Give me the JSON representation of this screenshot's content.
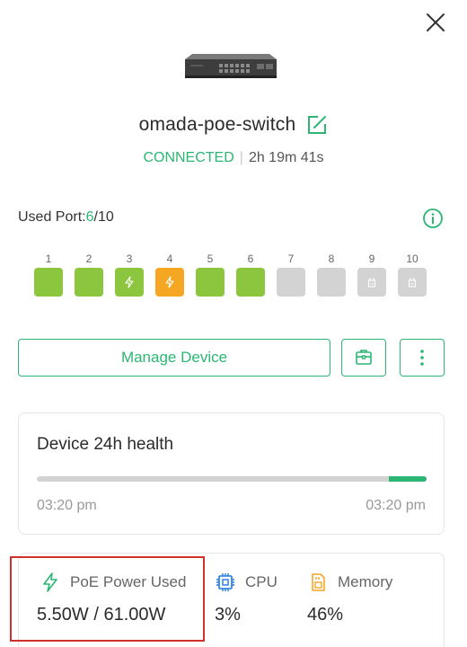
{
  "device": {
    "name": "omada-poe-switch",
    "status": "CONNECTED",
    "uptime": "2h 19m 41s"
  },
  "ports": {
    "label": "Used Port:",
    "used": "6",
    "total": "/10",
    "items": [
      {
        "num": "1",
        "state": "connected",
        "color": "#8cc63f"
      },
      {
        "num": "2",
        "state": "connected",
        "color": "#8cc63f"
      },
      {
        "num": "3",
        "state": "poe",
        "color": "#8cc63f"
      },
      {
        "num": "4",
        "state": "poe-warning",
        "color": "#f5a623"
      },
      {
        "num": "5",
        "state": "connected",
        "color": "#8cc63f"
      },
      {
        "num": "6",
        "state": "connected",
        "color": "#8cc63f"
      },
      {
        "num": "7",
        "state": "disconnected",
        "color": "#d3d3d3"
      },
      {
        "num": "8",
        "state": "disconnected",
        "color": "#d3d3d3"
      },
      {
        "num": "9",
        "state": "sfp",
        "color": "#d3d3d3"
      },
      {
        "num": "10",
        "state": "sfp",
        "color": "#d3d3d3"
      }
    ]
  },
  "actions": {
    "manage_label": "Manage Device"
  },
  "health": {
    "title": "Device 24h health",
    "start_time": "03:20 pm",
    "end_time": "03:20 pm"
  },
  "stats": {
    "poe_label": "PoE Power Used",
    "poe_value": "5.50W / 61.00W",
    "cpu_label": "CPU",
    "cpu_value": "3%",
    "memory_label": "Memory",
    "memory_value": "46%"
  },
  "colors": {
    "accent": "#2bb673",
    "port_green": "#8cc63f",
    "port_orange": "#f5a623",
    "port_gray": "#d3d3d3",
    "highlight": "#d0312d"
  }
}
